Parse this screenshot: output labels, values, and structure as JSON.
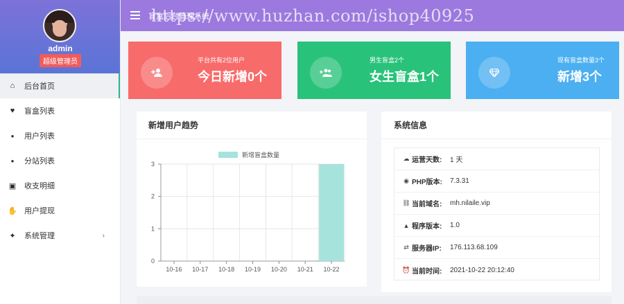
{
  "sidebar": {
    "admin_name": "admin",
    "admin_role": "超级管理员",
    "items": [
      {
        "label": "后台首页",
        "icon": "home-icon",
        "glyph": "⌂"
      },
      {
        "label": "盲盒列表",
        "icon": "heart-icon",
        "glyph": "♥"
      },
      {
        "label": "用户列表",
        "icon": "user-icon",
        "glyph": "●"
      },
      {
        "label": "分站列表",
        "icon": "user-icon",
        "glyph": "●"
      },
      {
        "label": "收支明细",
        "icon": "wallet-icon",
        "glyph": "▣"
      },
      {
        "label": "用户提现",
        "icon": "hand-icon",
        "glyph": "✋"
      },
      {
        "label": "系统管理",
        "icon": "sparkle-icon",
        "glyph": "✦",
        "arrow": "›"
      }
    ]
  },
  "header": {
    "title": "盲盒后台管理系统",
    "watermark": "https://www.huzhan.com/ishop40925",
    "color": "#9b79de"
  },
  "stats": [
    {
      "sub": "平台共有2位用户",
      "big": "今日新增0个",
      "icon": "add-user-icon",
      "color": "#f86b6b"
    },
    {
      "sub": "男生盲盒2个",
      "big": "女生盲盒1个",
      "icon": "group-add-icon",
      "color": "#29c27a"
    },
    {
      "sub": "现有盲盒数量3个",
      "big": "新增3个",
      "icon": "diamond-icon",
      "color": "#4baff1"
    }
  ],
  "chart_panel": {
    "title": "新增用户趋势"
  },
  "chart_data": {
    "type": "bar",
    "categories": [
      "10-16",
      "10-17",
      "10-18",
      "10-19",
      "10-20",
      "10-21",
      "10-22"
    ],
    "series": [
      {
        "name": "新增盲盒数量",
        "values": [
          0,
          0,
          0,
          0,
          0,
          0,
          3
        ],
        "color": "#a6e3dc"
      }
    ],
    "yticks": [
      "0",
      "1",
      "2",
      "3"
    ],
    "ylim": [
      0,
      3
    ],
    "legend": "top",
    "grid": true
  },
  "info_panel": {
    "title": "系统信息",
    "rows": [
      {
        "label": "运营天数:",
        "value": "1 天",
        "icon": "cloud-icon",
        "glyph": "☁"
      },
      {
        "label": "PHP版本:",
        "value": "7.3.31",
        "icon": "eye-icon",
        "glyph": "◉"
      },
      {
        "label": "当前域名:",
        "value": "mh.nilaile.vip",
        "icon": "link-icon",
        "glyph": "⛓"
      },
      {
        "label": "程序版本:",
        "value": "1.0",
        "icon": "android-icon",
        "glyph": "▲"
      },
      {
        "label": "服务器IP:",
        "value": "176.113.68.109",
        "icon": "shuffle-icon",
        "glyph": "⇄"
      },
      {
        "label": "当前时间:",
        "value": "2021-10-22 20:12:40",
        "icon": "alarm-icon",
        "glyph": "⏰"
      }
    ]
  }
}
